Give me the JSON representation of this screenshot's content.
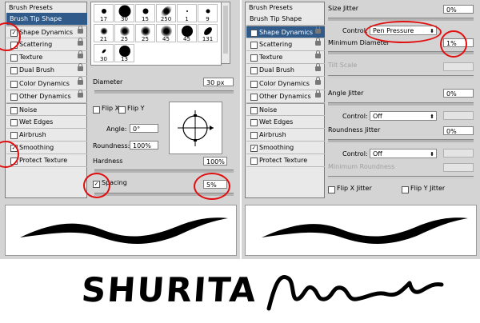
{
  "left_panel": {
    "presets_label": "Brush Presets",
    "items": [
      {
        "label": "Brush Tip Shape",
        "checkbox": false,
        "checked": false,
        "selected": true
      },
      {
        "label": "Shape Dynamics",
        "checkbox": true,
        "checked": true,
        "selected": false
      },
      {
        "label": "Scattering",
        "checkbox": true,
        "checked": false,
        "selected": false
      },
      {
        "label": "Texture",
        "checkbox": true,
        "checked": false,
        "selected": false
      },
      {
        "label": "Dual Brush",
        "checkbox": true,
        "checked": false,
        "selected": false
      },
      {
        "label": "Color Dynamics",
        "checkbox": true,
        "checked": false,
        "selected": false
      },
      {
        "label": "Other Dynamics",
        "checkbox": true,
        "checked": false,
        "selected": false
      },
      {
        "label": "Noise",
        "checkbox": true,
        "checked": false,
        "selected": false
      },
      {
        "label": "Wet Edges",
        "checkbox": true,
        "checked": false,
        "selected": false
      },
      {
        "label": "Airbrush",
        "checkbox": true,
        "checked": false,
        "selected": false
      },
      {
        "label": "Smoothing",
        "checkbox": true,
        "checked": true,
        "selected": false
      },
      {
        "label": "Protect Texture",
        "checkbox": true,
        "checked": false,
        "selected": false
      }
    ],
    "brush_sizes": [
      "17",
      "30",
      "15",
      "250",
      "1",
      "9",
      "21",
      "25",
      "25",
      "45",
      "45",
      "131",
      "30",
      "13"
    ],
    "diameter_label": "Diameter",
    "diameter_value": "30 px",
    "flip_x_label": "Flip X",
    "flip_y_label": "Flip Y",
    "angle_label": "Angle:",
    "angle_value": "0°",
    "roundness_label": "Roundness:",
    "roundness_value": "100%",
    "hardness_label": "Hardness",
    "hardness_value": "100%",
    "spacing_label": "Spacing",
    "spacing_checked": true,
    "spacing_value": "5%"
  },
  "right_panel": {
    "presets_label": "Brush Presets",
    "items": [
      {
        "label": "Brush Tip Shape",
        "checkbox": false,
        "checked": false,
        "selected": false
      },
      {
        "label": "Shape Dynamics",
        "checkbox": true,
        "checked": true,
        "selected": true
      },
      {
        "label": "Scattering",
        "checkbox": true,
        "checked": false,
        "selected": false
      },
      {
        "label": "Texture",
        "checkbox": true,
        "checked": false,
        "selected": false
      },
      {
        "label": "Dual Brush",
        "checkbox": true,
        "checked": false,
        "selected": false
      },
      {
        "label": "Color Dynamics",
        "checkbox": true,
        "checked": false,
        "selected": false
      },
      {
        "label": "Other Dynamics",
        "checkbox": true,
        "checked": false,
        "selected": false
      },
      {
        "label": "Noise",
        "checkbox": true,
        "checked": false,
        "selected": false
      },
      {
        "label": "Wet Edges",
        "checkbox": true,
        "checked": false,
        "selected": false
      },
      {
        "label": "Airbrush",
        "checkbox": true,
        "checked": false,
        "selected": false
      },
      {
        "label": "Smoothing",
        "checkbox": true,
        "checked": true,
        "selected": false
      },
      {
        "label": "Protect Texture",
        "checkbox": true,
        "checked": false,
        "selected": false
      }
    ],
    "size_jitter_label": "Size Jitter",
    "size_jitter_value": "0%",
    "control_label": "Control:",
    "control_value": "Pen Pressure",
    "min_diameter_label": "Minimum Diameter",
    "min_diameter_value": "1%",
    "tilt_scale_label": "Tilt Scale",
    "angle_jitter_label": "Angle Jitter",
    "angle_jitter_value": "0%",
    "control2_label": "Control:",
    "control2_value": "Off",
    "roundness_jitter_label": "Roundness Jitter",
    "roundness_jitter_value": "0%",
    "control3_label": "Control:",
    "control3_value": "Off",
    "min_roundness_label": "Minimum Roundness",
    "flip_x_jitter_label": "Flip X Jitter",
    "flip_y_jitter_label": "Flip Y Jitter"
  },
  "handwriting_text": "SHURITA",
  "colors": {
    "highlight_ring": "#e01010",
    "selected_row": "#2f5a8a",
    "panel": "#d4d4d4"
  }
}
